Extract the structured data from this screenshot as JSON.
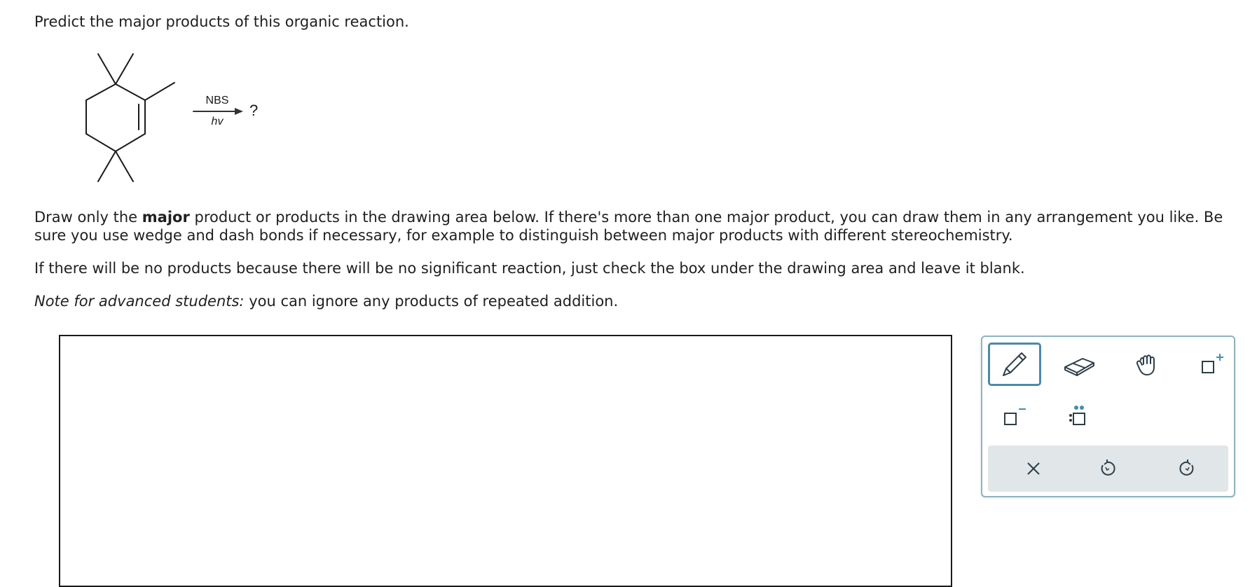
{
  "question": {
    "title": "Predict the major products of this organic reaction."
  },
  "reaction": {
    "reagent_top": "NBS",
    "reagent_bottom": "hv",
    "product": "?"
  },
  "instructions": {
    "line1_part1": "Draw only the ",
    "line1_bold": "major",
    "line1_part2": " product or products in the drawing area below. If there's more than one major product, you can draw them in any arrangement you like. Be sure you use wedge and dash bonds if necessary, for example to distinguish between major products with different stereochemistry.",
    "line2": "If there will be no products because there will be no significant reaction, just check the box under the drawing area and leave it blank.",
    "note_label": "Note for advanced students:",
    "note_text": " you can ignore any products of repeated addition."
  },
  "toolbar": {
    "tools": [
      "pencil",
      "eraser",
      "hand",
      "add-positive-charge",
      "add-negative-charge",
      "add-lone-pair"
    ],
    "active_tool": "pencil",
    "actions": [
      "clear",
      "undo",
      "redo"
    ],
    "accent_color": "#4a8aa8",
    "toolbar_border_color": "#8fb3c2",
    "actions_bg_color": "#e1e6e9"
  }
}
